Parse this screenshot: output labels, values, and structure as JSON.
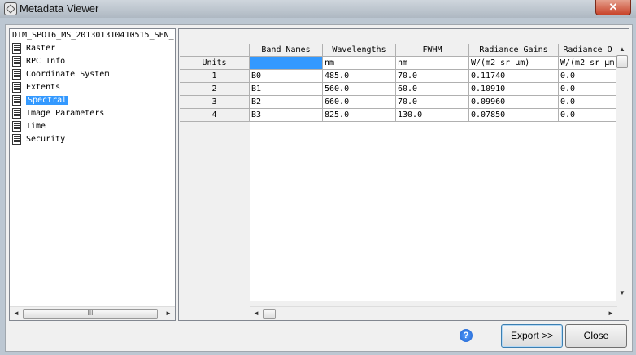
{
  "window": {
    "title": "Metadata Viewer",
    "close_glyph": "✕"
  },
  "tree": {
    "root": "DIM_SPOT6_MS_201301310410515_SEN_",
    "items": [
      {
        "label": "Raster",
        "selected": false
      },
      {
        "label": "RPC Info",
        "selected": false
      },
      {
        "label": "Coordinate System",
        "selected": false
      },
      {
        "label": "Extents",
        "selected": false
      },
      {
        "label": "Spectral",
        "selected": true
      },
      {
        "label": "Image Parameters",
        "selected": false
      },
      {
        "label": "Time",
        "selected": false
      },
      {
        "label": "Security",
        "selected": false
      }
    ],
    "scroll_left": "◄",
    "scroll_right": "►",
    "scroll_thumb": "III"
  },
  "grid": {
    "columns": [
      "Band Names",
      "Wavelengths",
      "FWHM",
      "Radiance Gains",
      "Radiance O"
    ],
    "units_label": "Units",
    "units": [
      "",
      "nm",
      "nm",
      "W/(m2 sr μm)",
      "W/(m2 sr μm"
    ],
    "rows": [
      {
        "num": "1",
        "cells": [
          "B0",
          "485.0",
          "70.0",
          "0.11740",
          "0.0"
        ]
      },
      {
        "num": "2",
        "cells": [
          "B1",
          "560.0",
          "60.0",
          "0.10910",
          "0.0"
        ]
      },
      {
        "num": "3",
        "cells": [
          "B2",
          "660.0",
          "70.0",
          "0.09960",
          "0.0"
        ]
      },
      {
        "num": "4",
        "cells": [
          "B3",
          "825.0",
          "130.0",
          "0.07850",
          "0.0"
        ]
      }
    ],
    "scroll_up": "▲",
    "scroll_down": "▼",
    "scroll_left": "◄",
    "scroll_right": "►"
  },
  "buttons": {
    "help": "?",
    "export": "Export >>",
    "close": "Close"
  }
}
